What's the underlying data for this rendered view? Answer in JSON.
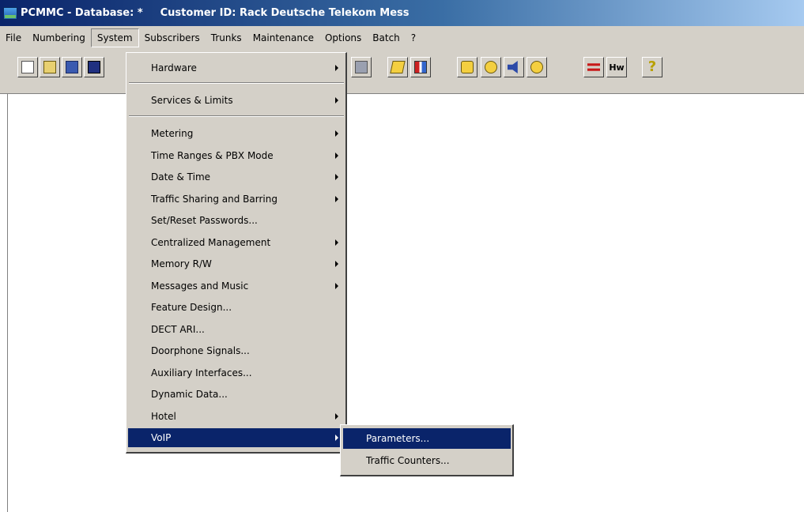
{
  "window": {
    "title_app": "PCMMC - Database: *",
    "title_customer": "Customer ID: Rack Deutsche Telekom Mess"
  },
  "menubar": [
    "File",
    "Numbering",
    "System",
    "Subscribers",
    "Trunks",
    "Maintenance",
    "Options",
    "Batch",
    "?"
  ],
  "toolbar": {
    "hw_label": "Hw",
    "help_glyph": "?",
    "icons": [
      "new-icon",
      "open-icon",
      "save-icon",
      "save-all-icon",
      "grey-tool-icon",
      "folder-tool-icon",
      "panel-icon",
      "phone-icon",
      "coil-icon",
      "speaker-icon",
      "coil-icon-2",
      "red-switch-icon",
      "hardware-icon",
      "help-icon"
    ]
  },
  "system_menu": {
    "items": [
      {
        "label": "Hardware",
        "submenu": true
      },
      {
        "label": "Services & Limits",
        "submenu": true
      },
      {
        "label": "Metering",
        "submenu": true
      },
      {
        "label": "Time Ranges & PBX Mode",
        "submenu": true
      },
      {
        "label": "Date & Time",
        "submenu": true
      },
      {
        "label": "Traffic Sharing and Barring",
        "submenu": true
      },
      {
        "label": "Set/Reset Passwords...",
        "submenu": false
      },
      {
        "label": "Centralized Management",
        "submenu": true
      },
      {
        "label": "Memory R/W",
        "submenu": true
      },
      {
        "label": "Messages and Music",
        "submenu": true
      },
      {
        "label": "Feature Design...",
        "submenu": false
      },
      {
        "label": "DECT ARI...",
        "submenu": false
      },
      {
        "label": "Doorphone Signals...",
        "submenu": false
      },
      {
        "label": "Auxiliary Interfaces...",
        "submenu": false
      },
      {
        "label": "Dynamic Data...",
        "submenu": false
      },
      {
        "label": "Hotel",
        "submenu": true
      },
      {
        "label": "VoIP",
        "submenu": true,
        "highlighted": true
      }
    ]
  },
  "voip_submenu": {
    "items": [
      {
        "label": "Parameters...",
        "highlighted": true
      },
      {
        "label": "Traffic Counters...",
        "highlighted": false
      }
    ]
  },
  "colors": {
    "highlight": "#0a246a",
    "face": "#d4d0c8",
    "title_start": "#0a246a",
    "title_end": "#a6caf0"
  }
}
